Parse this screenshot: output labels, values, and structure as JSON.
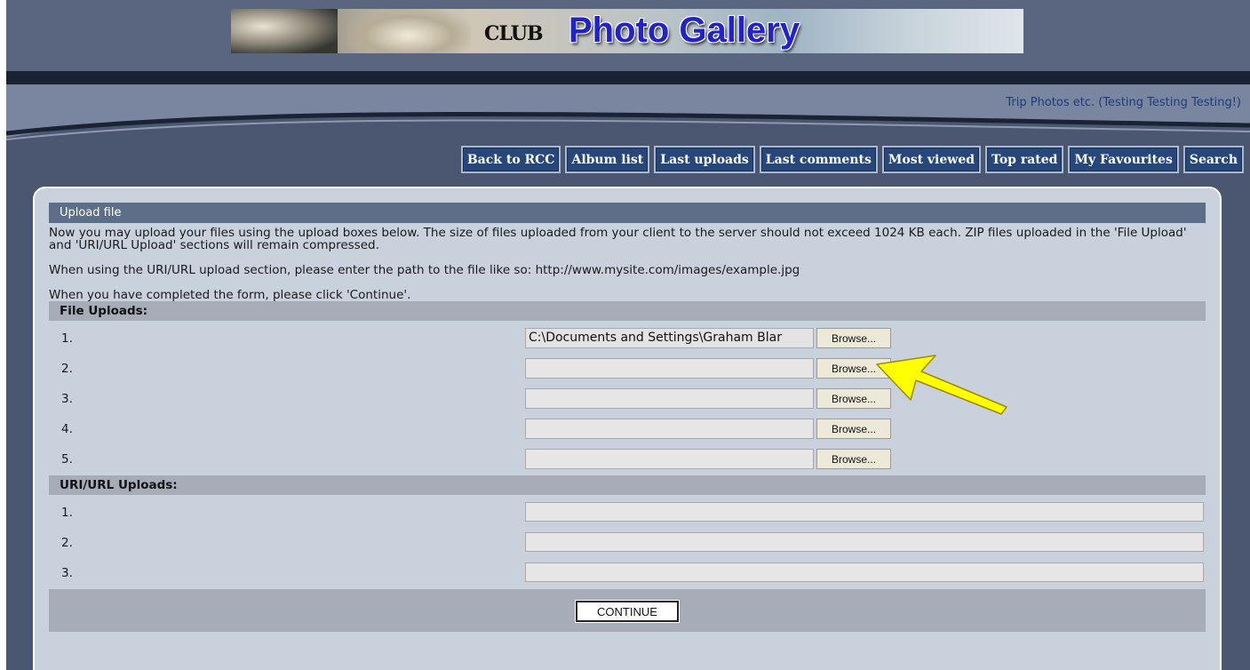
{
  "header": {
    "logo_text": "CLUB",
    "gallery_title": "Photo Gallery",
    "subtitle": "Trip Photos etc. (Testing Testing Testing!)"
  },
  "nav": [
    {
      "label": "Back to RCC"
    },
    {
      "label": "Album list"
    },
    {
      "label": "Last uploads"
    },
    {
      "label": "Last comments"
    },
    {
      "label": "Most viewed"
    },
    {
      "label": "Top rated"
    },
    {
      "label": "My Favourites"
    },
    {
      "label": "Search"
    }
  ],
  "upload": {
    "title": "Upload file",
    "intro_1": "Now you may upload your files using the upload boxes below. The size of files uploaded from your client to the server should not exceed 1024 KB each. ZIP files uploaded in the 'File Upload' and 'URI/URL Upload' sections will remain compressed.",
    "intro_2": "When using the URI/URL upload section, please enter the path to the file like so: http://www.mysite.com/images/example.jpg",
    "intro_3": "When you have completed the form, please click 'Continue'.",
    "file_section_title": "File Uploads:",
    "browse_label": "Browse...",
    "file_rows": [
      {
        "num": "1.",
        "value": "C:\\Documents and Settings\\Graham Blar"
      },
      {
        "num": "2.",
        "value": ""
      },
      {
        "num": "3.",
        "value": ""
      },
      {
        "num": "4.",
        "value": ""
      },
      {
        "num": "5.",
        "value": ""
      }
    ],
    "url_section_title": "URI/URL Uploads:",
    "url_rows": [
      {
        "num": "1.",
        "value": ""
      },
      {
        "num": "2.",
        "value": ""
      },
      {
        "num": "3.",
        "value": ""
      }
    ],
    "continue_label": "CONTINUE"
  },
  "colors": {
    "page_bg": "#4b5770",
    "panel_bg": "#c9d1dc",
    "nav_button_bg": "#27477a",
    "section_bg": "#a7adb8",
    "arrow": "#ffff00"
  },
  "icons": {
    "annotation": "yellow-arrow-icon"
  }
}
